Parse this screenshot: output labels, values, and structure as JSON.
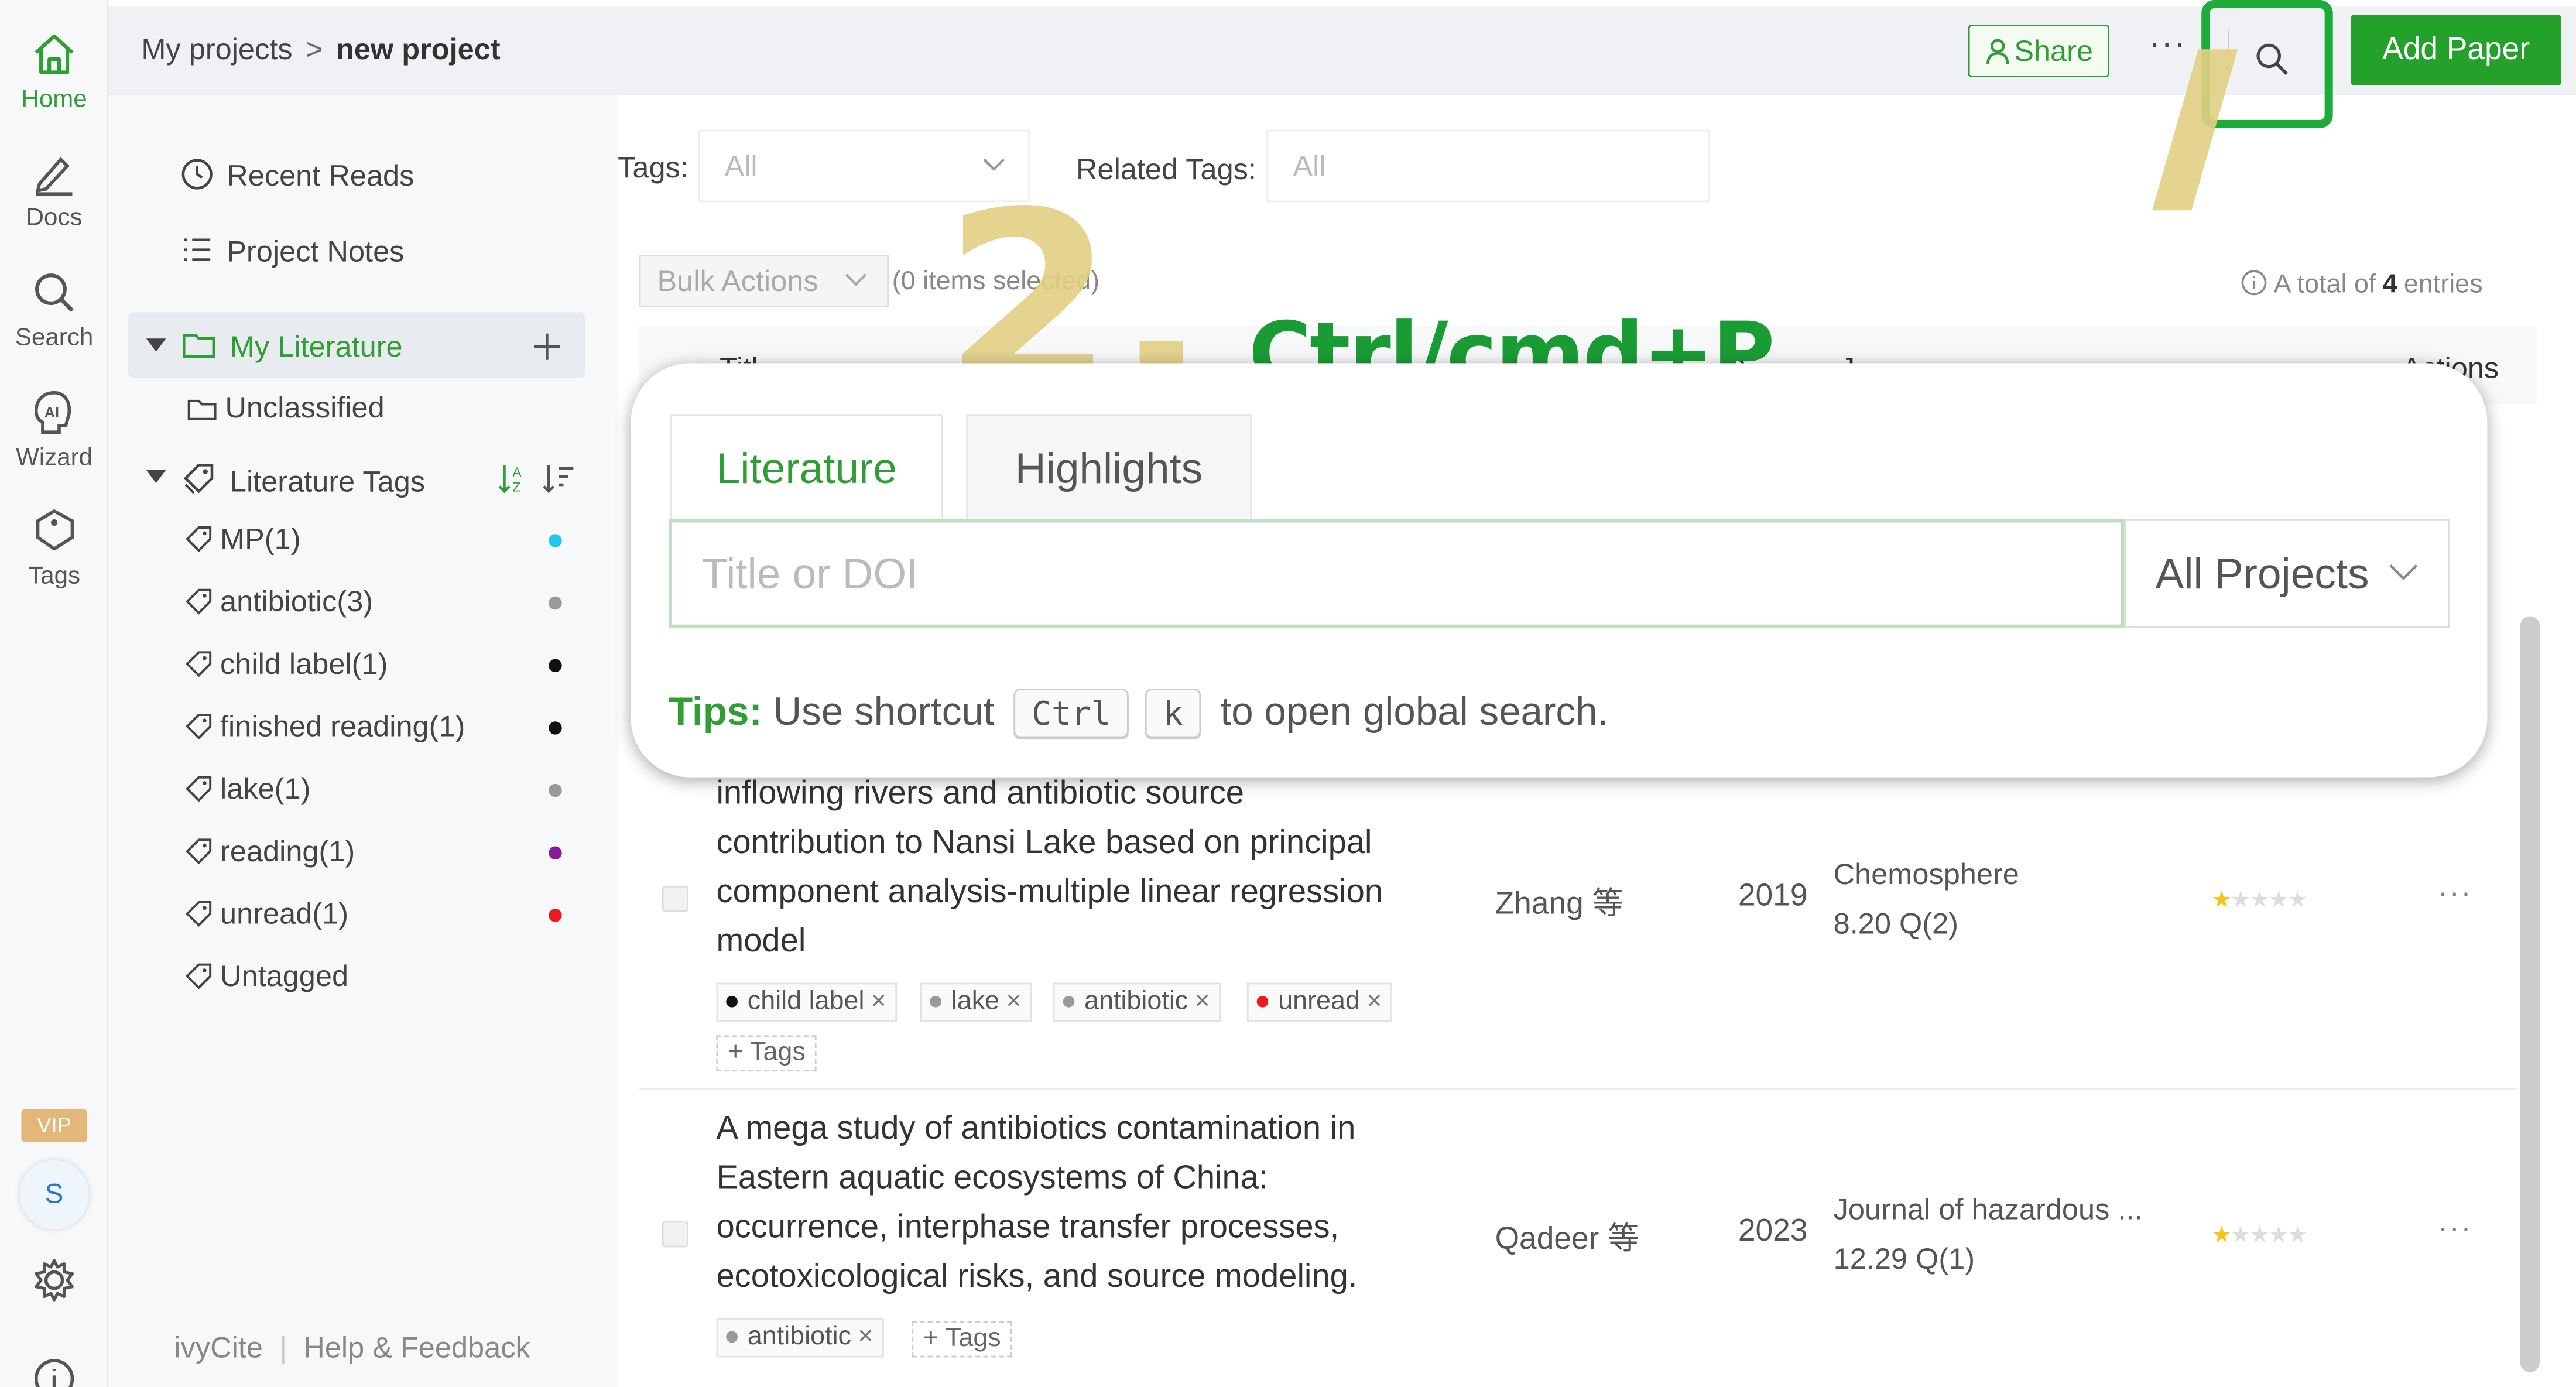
{
  "rail": {
    "home": "Home",
    "docs": "Docs",
    "search": "Search",
    "wizard": "Wizard",
    "tags": "Tags",
    "vip": "VIP",
    "avatar": "S"
  },
  "header": {
    "crumb_root": "My projects",
    "crumb_sep": ">",
    "crumb_current": "new project",
    "share": "Share",
    "more": "···",
    "add_paper": "Add Paper"
  },
  "sidebar": {
    "recent_reads": "Recent Reads",
    "project_notes": "Project Notes",
    "my_literature": "My Literature",
    "unclassified": "Unclassified",
    "literature_tags": "Literature Tags",
    "tags": [
      {
        "label": "MP(1)",
        "color": "#21c7e8"
      },
      {
        "label": "antibiotic(3)",
        "color": "#999999"
      },
      {
        "label": "child label(1)",
        "color": "#111111"
      },
      {
        "label": "finished reading(1)",
        "color": "#111111"
      },
      {
        "label": "lake(1)",
        "color": "#999999"
      },
      {
        "label": "reading(1)",
        "color": "#8a1a9c"
      },
      {
        "label": "unread(1)",
        "color": "#e81c1c"
      },
      {
        "label": "Untagged",
        "color": ""
      }
    ],
    "footer_brand": "ivyCite",
    "footer_help": "Help & Feedback"
  },
  "filters": {
    "tags_label": "Tags:",
    "tags_value": "All",
    "related_label": "Related Tags:",
    "related_value": "All"
  },
  "table": {
    "bulk_actions": "Bulk Actions",
    "selected": "(0 items selected)",
    "total_prefix": "A total of",
    "total_count": "4",
    "total_suffix": "entries",
    "header_title": "Titl",
    "header_date": "D",
    "header_journal": "J",
    "header_actions": "Actions",
    "add_tags": "Tags",
    "rows": [
      {
        "title_lines": [
          "inflowing rivers and antibiotic source",
          "contribution to Nansi Lake based on principal",
          "component analysis-multiple linear regression",
          "model"
        ],
        "author": "Zhang 等",
        "year": "2019",
        "journal": "Chemosphere",
        "impact": "8.20 Q(2)",
        "rating": 1,
        "tags": [
          {
            "label": "child label",
            "color": "#111111"
          },
          {
            "label": "lake",
            "color": "#999999"
          },
          {
            "label": "antibiotic",
            "color": "#999999"
          },
          {
            "label": "unread",
            "color": "#e81c1c"
          }
        ]
      },
      {
        "title_lines": [
          "A mega study of antibiotics contamination in",
          "Eastern aquatic ecosystems of China:",
          "occurrence, interphase transfer processes,",
          "ecotoxicological risks, and source modeling."
        ],
        "author": "Qadeer 等",
        "year": "2023",
        "journal": "Journal of hazardous ...",
        "impact": "12.29 Q(1)",
        "rating": 1,
        "tags": [
          {
            "label": "antibiotic",
            "color": "#999999"
          }
        ]
      }
    ]
  },
  "annotations": {
    "step_number": "2.",
    "shortcut": "Ctrl/cmd+P"
  },
  "search_modal": {
    "tab_literature": "Literature",
    "tab_highlights": "Highlights",
    "placeholder": "Title or DOI",
    "scope": "All Projects",
    "tips_label": "Tips:",
    "tips_text_before": "Use shortcut",
    "key1": "Ctrl",
    "key2": "k",
    "tips_text_after": "to open global search."
  },
  "colors": {
    "accent_green": "#24a12a",
    "highlight_box": "#1fab3a",
    "annotation_yellow": "#e3cf84"
  }
}
